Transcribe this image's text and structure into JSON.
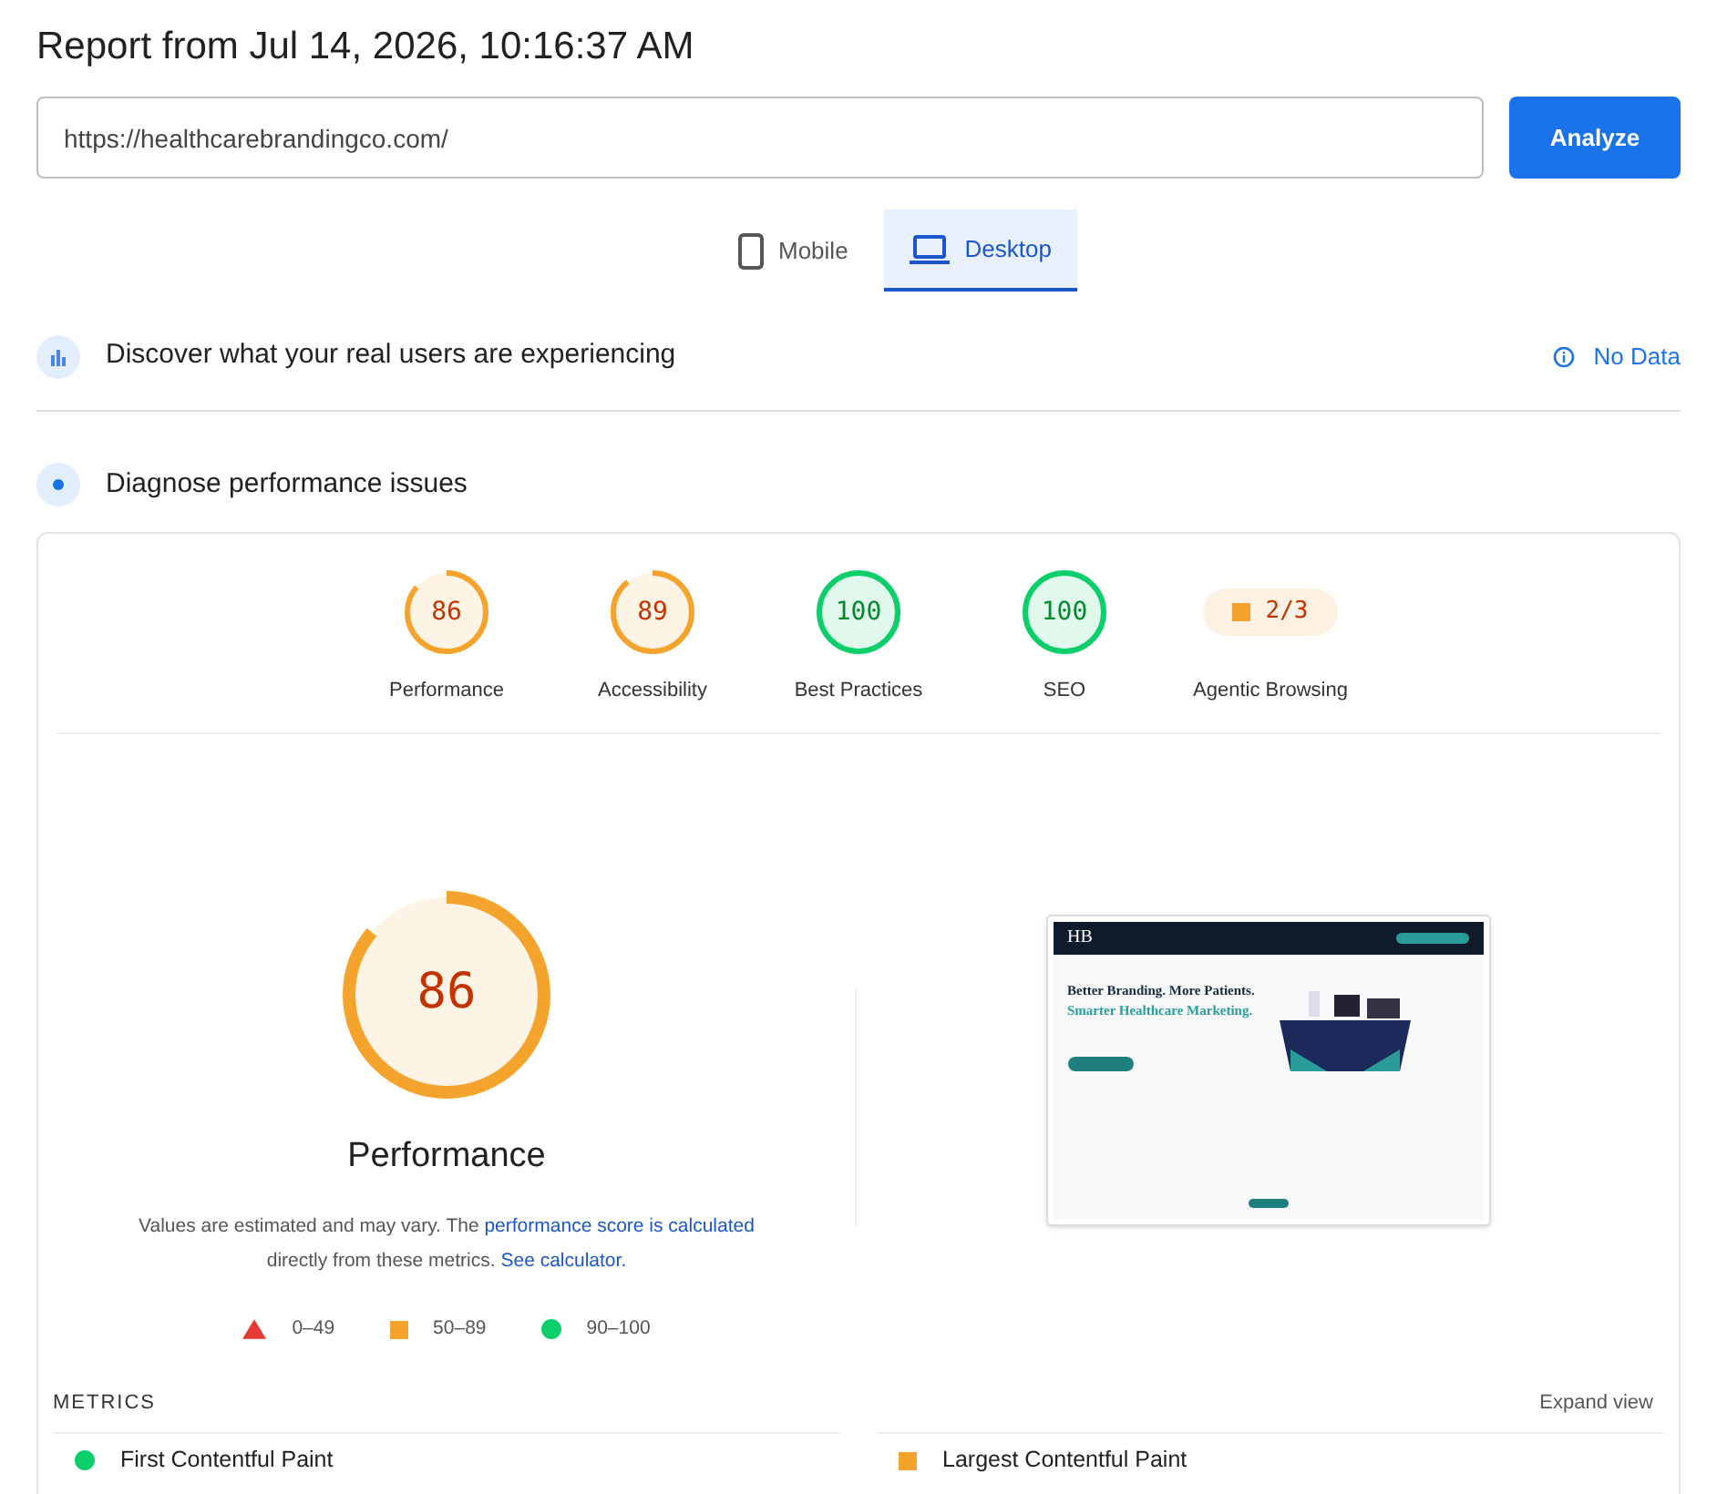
{
  "title": "Report from Jul 14, 2026, 10:16:37 AM",
  "url_field": {
    "value": "https://healthcarebrandingco.com/"
  },
  "analyze_button": "Analyze",
  "device_tabs": [
    {
      "label": "Mobile",
      "kind": "phone",
      "selected": false
    },
    {
      "label": "Desktop",
      "kind": "laptop",
      "selected": true
    }
  ],
  "field_data": {
    "heading": "Discover what your real users are experiencing",
    "status": "No Data"
  },
  "diagnose": {
    "heading": "Diagnose performance issues"
  },
  "categories": [
    {
      "kind": "gauge",
      "score": "86",
      "label": "Performance",
      "level": 0.86,
      "color": "#f4a42c"
    },
    {
      "kind": "gauge",
      "score": "89",
      "label": "Accessibility",
      "level": 0.89,
      "color": "#f4a42c"
    },
    {
      "kind": "gauge",
      "score": "100",
      "label": "Best Practices",
      "level": 1,
      "color": "#0cce6b"
    },
    {
      "kind": "gauge",
      "score": "100",
      "label": "SEO",
      "level": 1,
      "color": "#0cce6b"
    },
    {
      "kind": "fraction",
      "score": "2/3",
      "label": "Agentic Browsing",
      "color": "#f4a42c"
    }
  ],
  "main_gauge": {
    "score": "86",
    "label": "Performance",
    "level": 0.86,
    "color": "#f4a42c"
  },
  "note": {
    "text_before": "Values are estimated and may vary. The",
    "link1": "performance score is calculated",
    "text_middle": "directly from these metrics.",
    "link2": "See calculator."
  },
  "legend": [
    {
      "kind": "triangle",
      "label": "0–49",
      "color": "#e53935"
    },
    {
      "kind": "square",
      "label": "50–89",
      "color": "#f4a42c"
    },
    {
      "kind": "circle",
      "label": "90–100",
      "color": "#0cce6b"
    }
  ],
  "screenshot": {
    "logo": "HB",
    "headline": "Better Branding. More Patients.",
    "subheadline": "Smarter Healthcare Marketing."
  },
  "metrics": {
    "heading": "METRICS",
    "expand": "Expand view",
    "rows": [
      {
        "kind": "circle",
        "label": "First Contentful Paint",
        "color": "#0cce6b"
      },
      {
        "kind": "square",
        "label": "Largest Contentful Paint",
        "color": "#f4a42c"
      }
    ]
  }
}
